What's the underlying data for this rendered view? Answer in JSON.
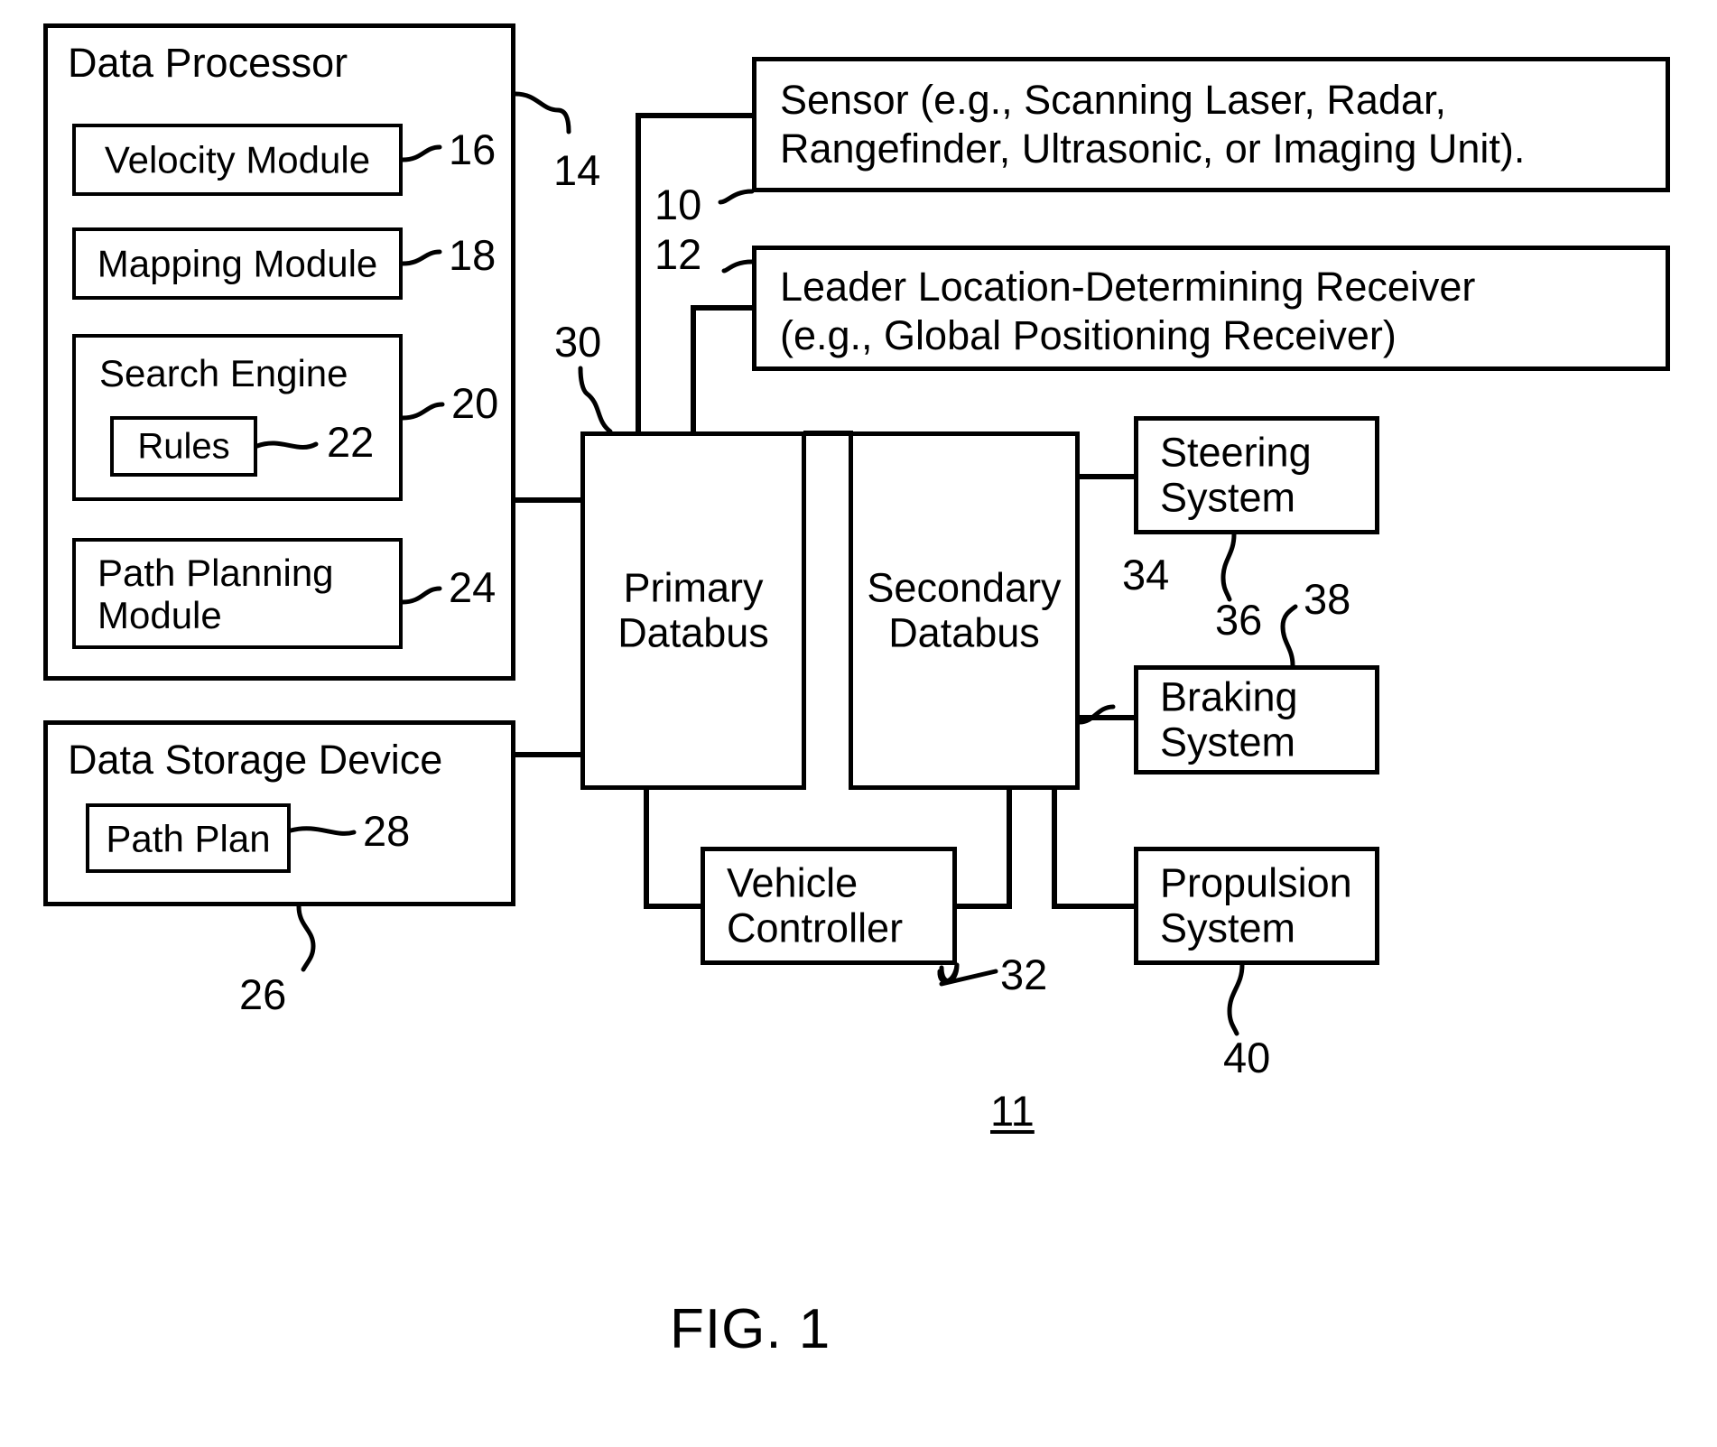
{
  "figure": {
    "caption": "FIG. 1",
    "system_ref": "11"
  },
  "boxes": {
    "data_processor": {
      "label": "Data Processor",
      "ref": "14"
    },
    "velocity_module": {
      "label": "Velocity Module",
      "ref": "16"
    },
    "mapping_module": {
      "label": "Mapping Module",
      "ref": "18"
    },
    "search_engine": {
      "label": "Search Engine",
      "ref": "20"
    },
    "rules": {
      "label": "Rules",
      "ref": "22"
    },
    "path_planning_module": {
      "label": "Path Planning\nModule",
      "ref": "24"
    },
    "data_storage_device": {
      "label": "Data Storage Device",
      "ref": "26"
    },
    "path_plan": {
      "label": "Path Plan",
      "ref": "28"
    },
    "sensor": {
      "label": "Sensor (e.g., Scanning Laser, Radar,\nRangefinder, Ultrasonic, or Imaging Unit).",
      "ref": "10"
    },
    "leader_receiver": {
      "label": "Leader Location-Determining Receiver\n(e.g., Global Positioning Receiver)",
      "ref": "12"
    },
    "primary_databus": {
      "label": "Primary\nDatabus",
      "ref": "30"
    },
    "secondary_databus": {
      "label": "Secondary\nDatabus",
      "ref": "34"
    },
    "vehicle_controller": {
      "label": "Vehicle\nController",
      "ref": "32"
    },
    "steering_system": {
      "label": "Steering\nSystem",
      "ref": "36"
    },
    "braking_system": {
      "label": "Braking\nSystem",
      "ref": "38"
    },
    "propulsion_system": {
      "label": "Propulsion\nSystem",
      "ref": "40"
    }
  }
}
